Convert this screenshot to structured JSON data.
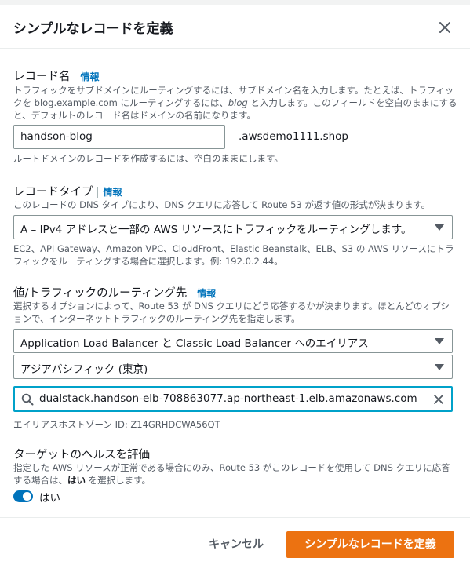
{
  "modal": {
    "title": "シンプルなレコードを定義",
    "close_icon": "close-icon"
  },
  "record_name": {
    "label": "レコード名",
    "info": "情報",
    "description_part1": "トラフィックをサブドメインにルーティングするには、サブドメイン名を入力します。たとえば、トラフィックを blog.example.com にルーティングするには、",
    "description_italic": "blog",
    "description_part2": " と入力します。このフィールドを空白のままにすると、デフォルトのレコード名はドメインの名前になります。",
    "value": "handson-blog",
    "domain_suffix": ".awsdemo1111.shop",
    "hint": "ルートドメインのレコードを作成するには、空白のままにします。"
  },
  "record_type": {
    "label": "レコードタイプ",
    "info": "情報",
    "description": "このレコードの DNS タイプにより、DNS クエリに応答して Route 53 が返す値の形式が決まります。",
    "selected": "A – IPv4 アドレスと一部の AWS リソースにトラフィックをルーティングします。",
    "hint": "EC2、API Gateway、Amazon VPC、CloudFront、Elastic Beanstalk、ELB、S3 の AWS リソースにトラフィックをルーティングする場合に選択します。例: 192.0.2.44。"
  },
  "routing_target": {
    "label": "値/トラフィックのルーティング先",
    "info": "情報",
    "description": "選択するオプションによって、Route 53 が DNS クエリにどう応答するかが決まります。ほとんどのオプションで、インターネットトラフィックのルーティング先を指定します。",
    "endpoint_selected": "Application Load Balancer と Classic Load Balancer へのエイリアス",
    "region_selected": "アジアパシフィック (東京)",
    "alias_value": "dualstack.handson-elb-708863077.ap-northeast-1.elb.amazonaws.com",
    "hosted_zone_text": "エイリアスホストゾーン ID: Z14GRHDCWA56QT"
  },
  "health": {
    "label": "ターゲットのヘルスを評価",
    "description_part1": "指定した AWS リソースが正常である場合にのみ、Route 53 がこのレコードを使用して DNS クエリに応答する場合は、",
    "description_bold": "はい",
    "description_part2": " を選択します。",
    "toggle_label": "はい",
    "toggle_on": true
  },
  "footer": {
    "cancel_label": "キャンセル",
    "submit_label": "シンプルなレコードを定義"
  },
  "colors": {
    "accent": "#0073bb",
    "primary_button": "#ec7211",
    "focus_border": "#00a1c9"
  }
}
